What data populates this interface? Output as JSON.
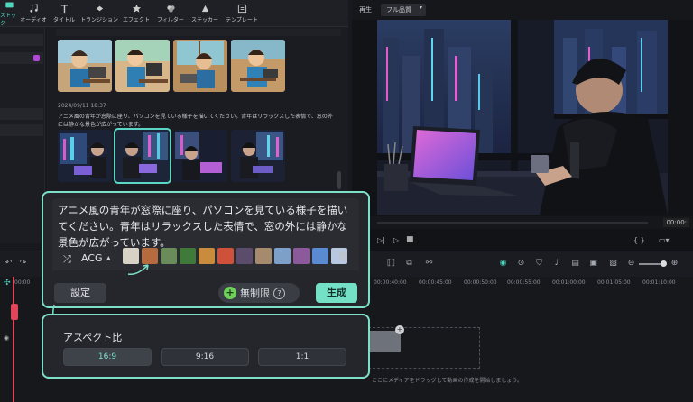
{
  "toolbar": {
    "items": [
      {
        "label": "ストック",
        "icon": "folder-icon"
      },
      {
        "label": "オーディオ",
        "icon": "music-icon"
      },
      {
        "label": "タイトル",
        "icon": "text-icon"
      },
      {
        "label": "トランジション",
        "icon": "transition-icon"
      },
      {
        "label": "エフェクト",
        "icon": "effects-icon"
      },
      {
        "label": "フィルター",
        "icon": "filter-icon"
      },
      {
        "label": "ステッカー",
        "icon": "sticker-icon"
      },
      {
        "label": "テンプレート",
        "icon": "template-icon"
      }
    ]
  },
  "media": {
    "timestamp": "2024/09/11 18:37",
    "description": "アニメ風の青年が窓際に座り、パソコンを見ている様子を描いてください。青年はリラックスした表情で、窓の外には静かな景色が広がっています。"
  },
  "preview": {
    "play_label": "再生",
    "quality_label": "フル品質",
    "timecode": "00:00:"
  },
  "prompt": {
    "text": "アニメ風の青年が窓際に座り、パソコンを見ている様子を描いてください。青年はリラックスした表情で、窓の外には静かな景色が広がっています。",
    "style_name": "ACG",
    "settings_label": "設定",
    "unlimited_label": "無制限",
    "generate_label": "生成"
  },
  "aspect": {
    "title": "アスペクト比",
    "options": [
      "16:9",
      "9:16",
      "1:1"
    ],
    "selected": "16:9"
  },
  "timeline": {
    "ticks": [
      "00:00",
      "00:00:40:00",
      "00:00:45:00",
      "00:00:50:00",
      "00:00:55:00",
      "00:01:00:00",
      "00:01:05:00",
      "00:01:10:00"
    ],
    "hint": "ここにメディアをドラッグして動画の作成を開始しましょう。"
  },
  "colors": {
    "accent": "#74e0c6",
    "panel": "#24262c",
    "bg": "#17181c"
  }
}
